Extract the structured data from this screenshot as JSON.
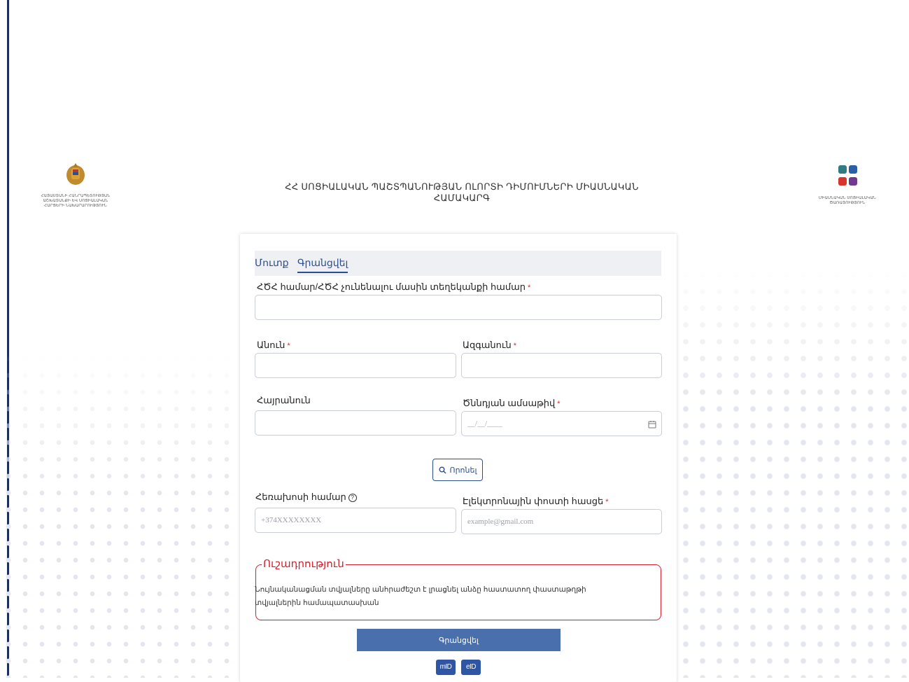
{
  "header": {
    "left_logo_caption": [
      "ՀԱՅԱՍՏԱՆԻ ՀԱՆՐԱՊԵՏՈՒԹՅԱՆ",
      "ԱՇԽԱՏԱՆՔԻ ԵՎ ՍՈՑԻԱԼԱԿԱՆ",
      "ՀԱՐՑԵՐԻ ՆԱԽԱՐԱՐՈՒԹՅՈՒՆ"
    ],
    "title": "ՀՀ ՍՈՑԻԱԼԱԿԱՆ ՊԱՇՏՊԱՆՈՒԹՅԱՆ ՈԼՈՐՏԻ ԴԻՄՈՒՄՆԵՐԻ ՄԻԱՍՆԱԿԱՆ ՀԱՄԱԿԱՐԳ",
    "right_logo_caption": [
      "ՄԻԱՍՆԱԿԱՆ ՍՈՑԻԱԼԱԿԱՆ",
      "ԾԱՌԱՅՈՒԹՅՈՒՆ"
    ],
    "logo_colors": [
      "#2e7d84",
      "#2a5fa8",
      "#d7342c",
      "#6f3a8e"
    ]
  },
  "tabs": {
    "login": "Մուտք",
    "register": "Գրանցվել",
    "active": "register"
  },
  "form": {
    "ssn_label": "ՀԾՀ համար/ՀԾՀ չունենալու մասին տեղեկանքի համար",
    "first_name_label": "Անուն",
    "last_name_label": "Ազգանուն",
    "patronymic_label": "Հայրանուն",
    "birth_date_label": "Ծննդյան ամսաթիվ",
    "birth_date_placeholder": "__/__/____",
    "required_mark": "*",
    "search_label": "Որոնել",
    "phone_label": "Հեռախոսի համար",
    "phone_placeholder": "+374XXXXXXXX",
    "email_label": "Էլեկտրոնային փոստի հասցե",
    "email_placeholder": "example@gmail.com"
  },
  "notice": {
    "title": "Ուշադրություն",
    "text": "Նույնականացման տվյալները անհրաժեշտ է լրացնել անձը հաստատող փաստաթղթի տվյալներին համապատասխան"
  },
  "actions": {
    "submit_label": "Գրանցվել",
    "mid_label": "mID",
    "eid_label": "eID"
  },
  "colors": {
    "accent": "#2e4d8f",
    "submit": "#4a6fad",
    "required": "#d4283a",
    "notice_border": "#d61f2e"
  }
}
